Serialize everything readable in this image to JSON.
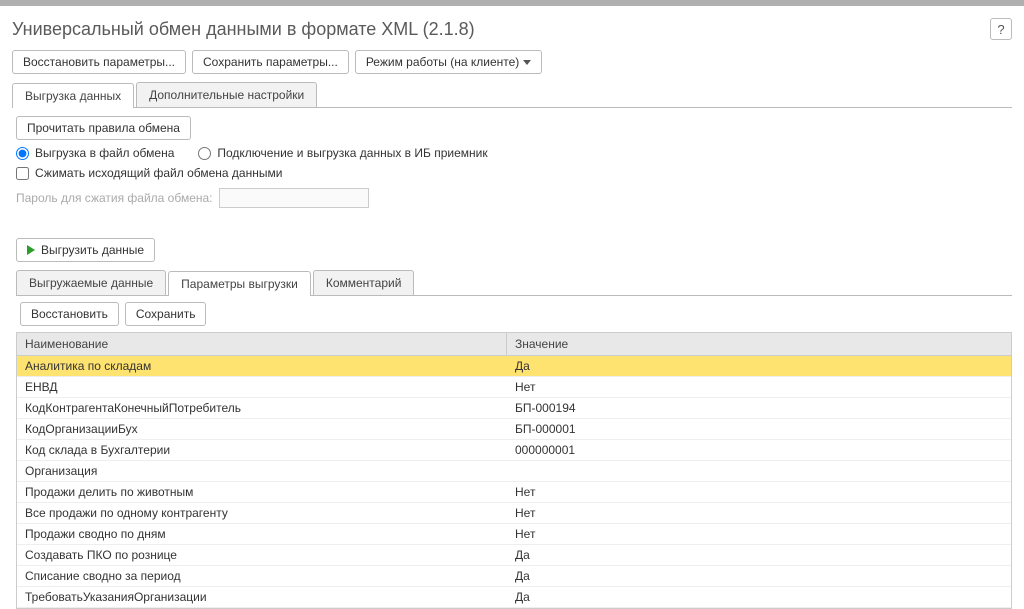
{
  "title": "Универсальный обмен данными в формате XML (2.1.8)",
  "help_label": "?",
  "toolbar": {
    "restore_params": "Восстановить параметры...",
    "save_params": "Сохранить параметры...",
    "mode": "Режим работы (на клиенте)"
  },
  "tabs_top": {
    "export": "Выгрузка данных",
    "settings": "Дополнительные настройки"
  },
  "read_rules": "Прочитать правила обмена",
  "radio": {
    "to_file": "Выгрузка в файл обмена",
    "to_ib": "Подключение и выгрузка данных в ИБ приемник"
  },
  "compress": "Сжимать исходящий файл обмена данными",
  "password_label": "Пароль для сжатия файла обмена:",
  "password_value": "",
  "export_btn": "Выгрузить данные",
  "tabs_inner": {
    "exported": "Выгружаемые данные",
    "params": "Параметры выгрузки",
    "comment": "Комментарий"
  },
  "inner_toolbar": {
    "restore": "Восстановить",
    "save": "Сохранить"
  },
  "table": {
    "headers": {
      "name": "Наименование",
      "value": "Значение"
    },
    "rows": [
      {
        "name": "Аналитика по складам",
        "value": "Да",
        "selected": true
      },
      {
        "name": "ЕНВД",
        "value": "Нет"
      },
      {
        "name": "КодКонтрагентаКонечныйПотребитель",
        "value": "БП-000194"
      },
      {
        "name": "КодОрганизацииБух",
        "value": "БП-000001"
      },
      {
        "name": "Код склада в Бухгалтерии",
        "value": "000000001"
      },
      {
        "name": "Организация",
        "value": ""
      },
      {
        "name": "Продажи делить по животным",
        "value": "Нет"
      },
      {
        "name": "Все продажи по одному контрагенту",
        "value": "Нет"
      },
      {
        "name": "Продажи сводно по дням",
        "value": "Нет"
      },
      {
        "name": "Создавать ПКО по рознице",
        "value": "Да"
      },
      {
        "name": "Списание сводно за период",
        "value": "Да"
      },
      {
        "name": "ТребоватьУказанияОрганизации",
        "value": "Да"
      }
    ]
  }
}
